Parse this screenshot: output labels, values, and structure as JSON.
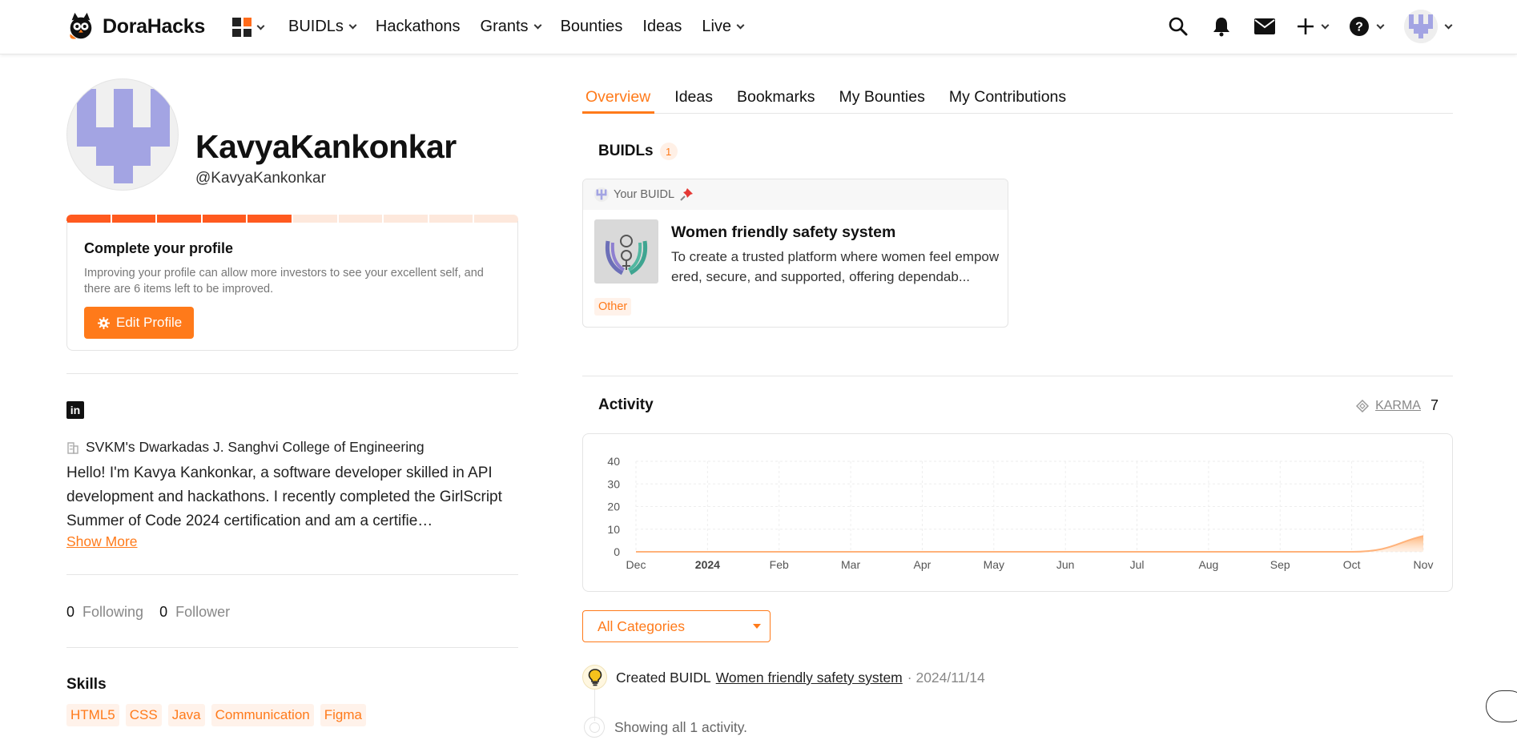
{
  "nav": {
    "logo_text": "DoraHacks",
    "links": [
      {
        "label": "BUIDLs",
        "dropdown": true
      },
      {
        "label": "Hackathons",
        "dropdown": false
      },
      {
        "label": "Grants",
        "dropdown": true
      },
      {
        "label": "Bounties",
        "dropdown": false
      },
      {
        "label": "Ideas",
        "dropdown": false
      },
      {
        "label": "Live",
        "dropdown": true
      }
    ],
    "right_icons": [
      "search-icon",
      "bell-icon",
      "mail-icon",
      "plus-icon",
      "help-icon",
      "avatar"
    ]
  },
  "profile": {
    "name": "KavyaKankonkar",
    "handle": "@KavyaKankonkar",
    "progress_filled_segments": 5,
    "progress_total_segments": 10,
    "complete_title": "Complete your profile",
    "complete_desc": "Improving your profile can allow more investors to see your excellent self, and there are 6 items left to be improved.",
    "edit_button": "Edit Profile",
    "college": "SVKM's Dwarkadas J. Sanghvi College of Engineering",
    "bio": "Hello! I'm Kavya Kankonkar, a software developer skilled in API development and hackathons. I recently completed the GirlScript Summer of Code 2024 certification and am a certified developer",
    "bio_display": "Hello! I'm Kavya Kankonkar, a software developer skilled in API development and hackathons. I recently completed the GirlScript Summer of Code 2024 certification and am a certifie…",
    "show_more": "Show More",
    "following_count": "0",
    "following_label": "Following",
    "follower_count": "0",
    "follower_label": "Follower",
    "skills_title": "Skills",
    "skills": [
      "HTML5",
      "CSS",
      "Java",
      "Communication",
      "Figma"
    ]
  },
  "tabs": [
    {
      "label": "Overview",
      "active": true
    },
    {
      "label": "Ideas",
      "active": false
    },
    {
      "label": "Bookmarks",
      "active": false
    },
    {
      "label": "My Bounties",
      "active": false
    },
    {
      "label": "My Contributions",
      "active": false
    }
  ],
  "buidls": {
    "title": "BUIDLs",
    "count": "1",
    "card": {
      "label": "Your BUIDL",
      "title": "Women friendly safety system",
      "description": "To create a trusted platform where women feel empowered, secure, and supported, offering dependab...",
      "tag": "Other"
    }
  },
  "activity": {
    "title": "Activity",
    "karma_label": "KARMA",
    "karma_value": "7",
    "category_select": "All Categories",
    "items": [
      {
        "prefix": "Created BUIDL",
        "link": "Women friendly safety system",
        "date": "· 2024/11/14"
      }
    ],
    "summary": "Showing all 1 activity."
  },
  "colors": {
    "accent": "#ff7a1a",
    "progress_fill": "#ff5a1f",
    "avatar_pattern": "#a3a4e3"
  },
  "chart_data": {
    "type": "area",
    "categories": [
      "Dec",
      "2024",
      "Feb",
      "Mar",
      "Apr",
      "May",
      "Jun",
      "Jul",
      "Aug",
      "Sep",
      "Oct",
      "Nov"
    ],
    "values": [
      0,
      0,
      0,
      0,
      0,
      0,
      0,
      0,
      0,
      0,
      0,
      7
    ],
    "yticks": [
      0,
      10,
      20,
      30,
      40
    ],
    "ylim": [
      0,
      40
    ],
    "bold_tick": "2024",
    "grid": true
  }
}
